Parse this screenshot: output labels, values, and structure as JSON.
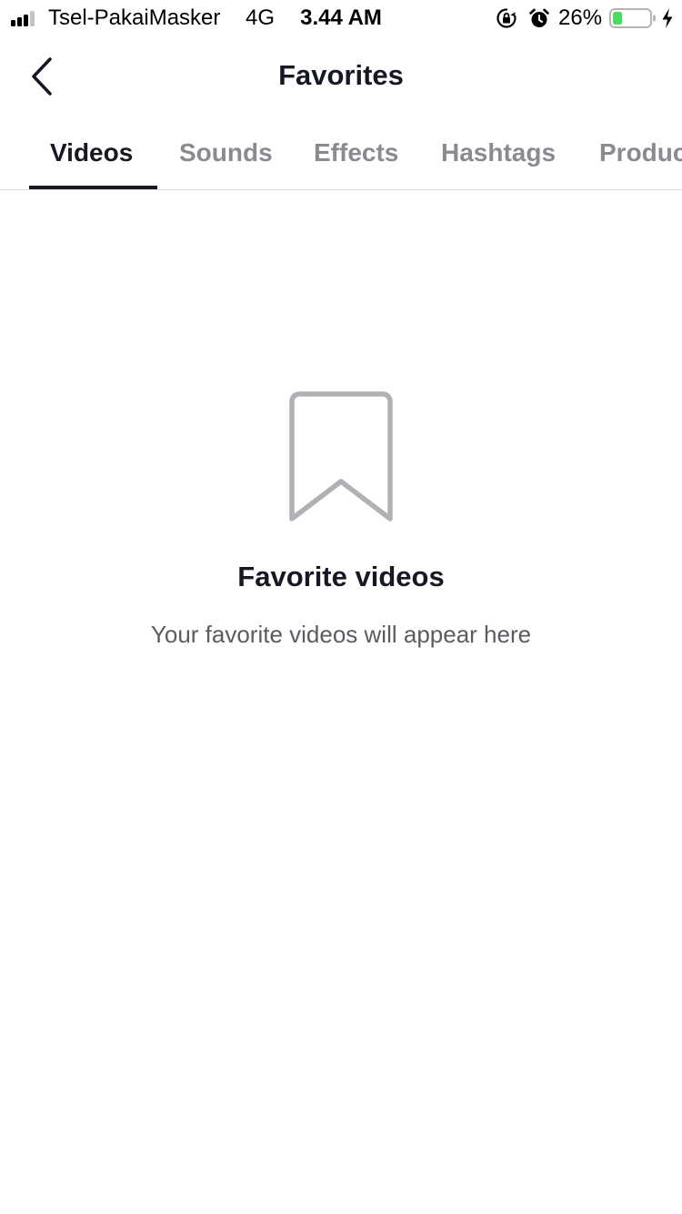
{
  "status_bar": {
    "carrier": "Tsel-PakaiMasker",
    "network": "4G",
    "time": "3.44 AM",
    "battery_percent": "26%",
    "battery_level": 0.26,
    "battery_fill_color": "#4cd964"
  },
  "header": {
    "title": "Favorites",
    "back_icon": "chevron-left-icon"
  },
  "tabs": [
    {
      "label": "Videos",
      "active": true
    },
    {
      "label": "Sounds",
      "active": false
    },
    {
      "label": "Effects",
      "active": false
    },
    {
      "label": "Hashtags",
      "active": false
    },
    {
      "label": "Products",
      "active": false
    }
  ],
  "empty_state": {
    "icon": "bookmark-icon",
    "title": "Favorite videos",
    "subtitle": "Your favorite videos will appear here"
  },
  "colors": {
    "text_primary": "#161823",
    "text_secondary": "#8a8b91",
    "icon_gray": "#b1b1b5",
    "divider": "#dcdcdc"
  }
}
